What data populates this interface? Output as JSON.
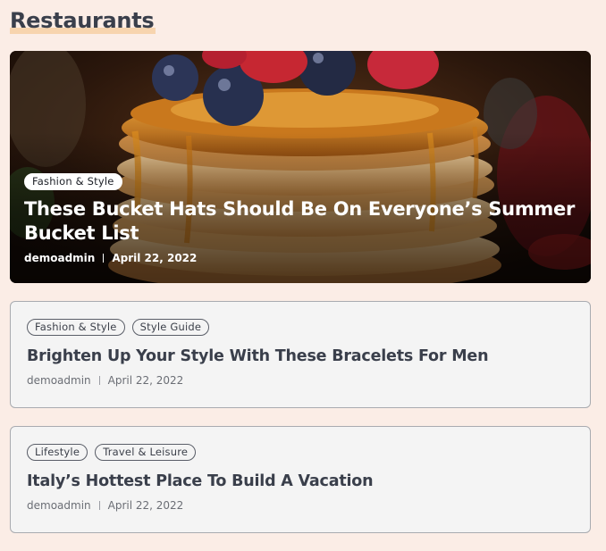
{
  "section": {
    "title": "Restaurants"
  },
  "featured": {
    "tags": [
      "Fashion & Style"
    ],
    "title": "These Bucket Hats Should Be On Everyone’s Summer Bucket List",
    "author": "demoadmin",
    "date": "April 22, 2022"
  },
  "posts": [
    {
      "tags": [
        "Fashion & Style",
        "Style Guide"
      ],
      "title": "Brighten Up Your Style With These Bracelets For Men",
      "author": "demoadmin",
      "date": "April 22, 2022"
    },
    {
      "tags": [
        "Lifestyle",
        "Travel & Leisure"
      ],
      "title": "Italy’s Hottest Place To Build A Vacation",
      "author": "demoadmin",
      "date": "April 22, 2022"
    }
  ],
  "colors": {
    "page_bg": "#fbede6",
    "title_highlight": "#f7d4ae",
    "card_bg": "#f4f4f4",
    "text_dark": "#3a3f4b"
  }
}
